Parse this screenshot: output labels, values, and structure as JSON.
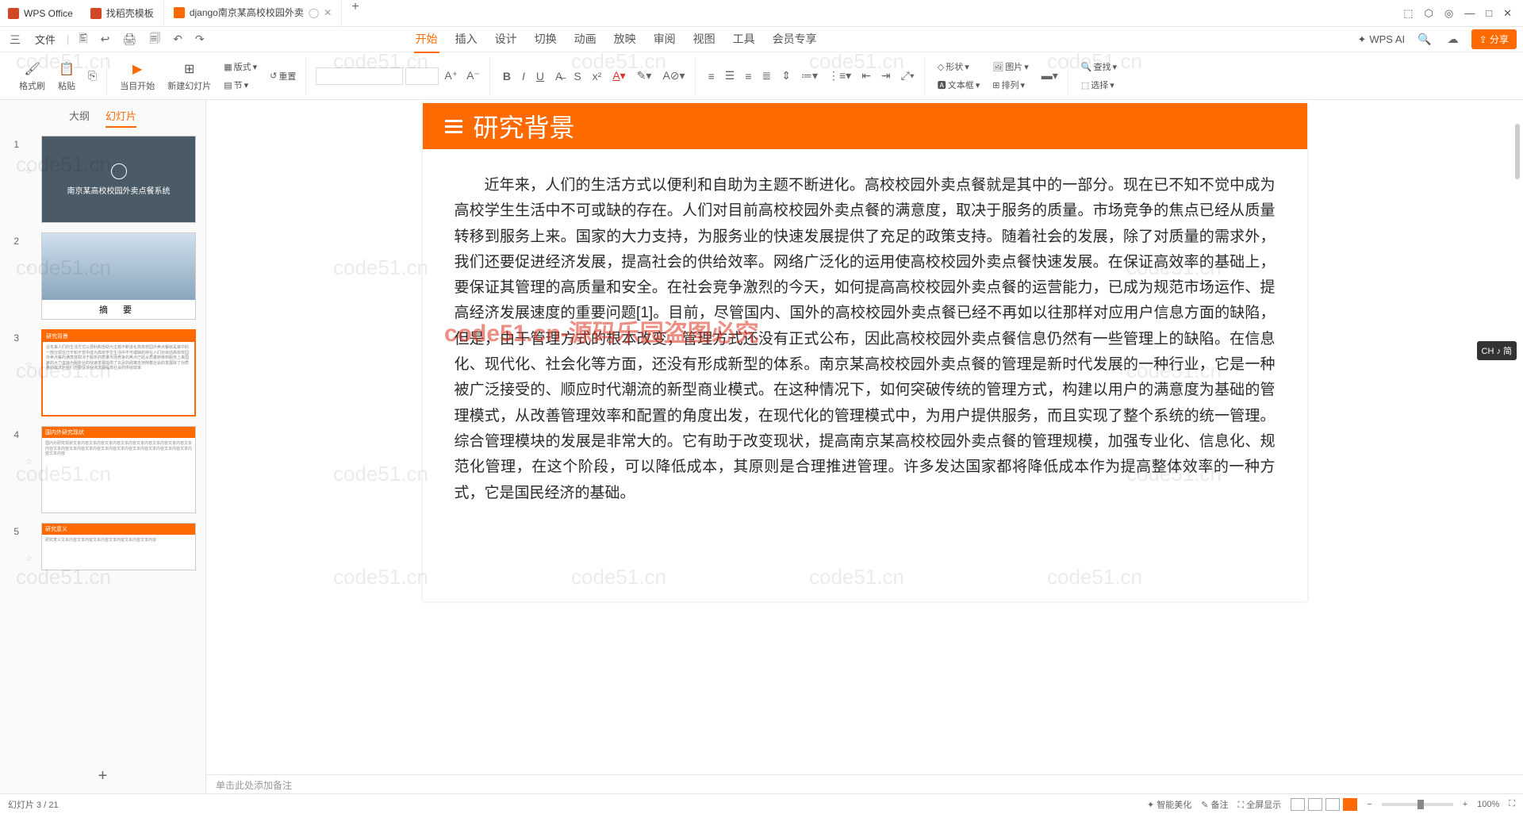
{
  "app": {
    "name": "WPS Office"
  },
  "doc_tabs": [
    {
      "label": "找稻壳模板",
      "active": false
    },
    {
      "label": "django南京某高校校园外卖",
      "active": true
    }
  ],
  "add_symbol": "+",
  "win": {
    "close": "✕",
    "max": "□",
    "min": "—",
    "o1": "⬚",
    "o2": "⬡",
    "o3": "◎"
  },
  "menu": {
    "left": {
      "hamburger": "三",
      "file": "文件"
    },
    "quick": [
      "🖺",
      "↩",
      "🖨",
      "🗐",
      "↶",
      "↷"
    ],
    "tabs": [
      "开始",
      "插入",
      "设计",
      "切换",
      "动画",
      "放映",
      "审阅",
      "视图",
      "工具",
      "会员专享"
    ],
    "active_tab": "开始",
    "right": {
      "ai": "WPS AI",
      "search_icon": "🔍",
      "cloud": "☁",
      "share": "分享"
    }
  },
  "ribbon": {
    "format_painter": "格式刷",
    "paste": "粘贴",
    "from_current": "当目开始",
    "new_slide": "新建幻灯片",
    "layout": "版式",
    "section": "节",
    "reset": "重置",
    "shape": "形状",
    "picture": "图片",
    "textbox": "文本框",
    "arrange": "排列",
    "find": "查找",
    "select": "选择"
  },
  "side": {
    "outline": "大纲",
    "slides": "幻灯片",
    "slide1_title": "南京某高校校园外卖点餐系统",
    "slide2_title": "摘    要",
    "slide3_header": "研究背景",
    "slide4_header": "国内外研究现状",
    "slide5_header": "研究意义",
    "nums": [
      "1",
      "2",
      "3",
      "4",
      "5"
    ]
  },
  "slide": {
    "header": "研究背景",
    "body": "近年来，人们的生活方式以便利和自助为主题不断进化。高校校园外卖点餐就是其中的一部分。现在已不知不觉中成为高校学生生活中不可或缺的存在。人们对目前高校校园外卖点餐的满意度，取决于服务的质量。市场竞争的焦点已经从质量转移到服务上来。国家的大力支持，为服务业的快速发展提供了充足的政策支持。随着社会的发展，除了对质量的需求外，我们还要促进经济发展，提高社会的供给效率。网络广泛化的运用使高校校园外卖点餐快速发展。在保证高效率的基础上，要保证其管理的高质量和安全。在社会竞争激烈的今天，如何提高高校校园外卖点餐的运营能力，已成为规范市场运作、提高经济发展速度的重要问题[1]。目前，尽管国内、国外的高校校园外卖点餐已经不再如以往那样对应用户信息方面的缺陷，但是，由于管理方式的根本改变，管理方式还没有正式公布，因此高校校园外卖点餐信息仍然有一些管理上的缺陷。在信息化、现代化、社会化等方面，还没有形成新型的体系。南京某高校校园外卖点餐的管理是新时代发展的一种行业，它是一种被广泛接受的、顺应时代潮流的新型商业模式。在这种情况下，如何突破传统的管理方式，构建以用户的满意度为基础的管理模式，从改善管理效率和配置的角度出发，在现代化的管理模式中，为用户提供服务，而且实现了整个系统的统一管理。综合管理模块的发展是非常大的。它有助于改变现状，提高南京某高校校园外卖点餐的管理规模，加强专业化、信息化、规范化管理，在这个阶段，可以降低成本，其原则是合理推进管理。许多发达国家都将降低成本作为提高整体效率的一种方式，它是国民经济的基础。"
  },
  "notes_placeholder": "单击此处添加备注",
  "status": {
    "left": "幻灯片 3 / 21",
    "smart_beautify": "智能美化",
    "notes": "备注",
    "fullscreen": "全屏显示",
    "zoom": "100%"
  },
  "watermark": "code51.cn",
  "watermark_red": "code51.cn-源码乐园盗图必究",
  "lang": "CH ♪ 简"
}
